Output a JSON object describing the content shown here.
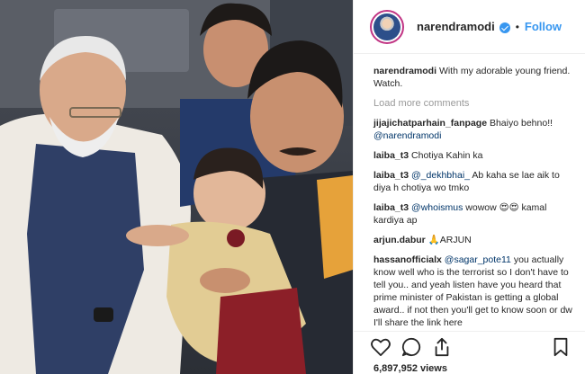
{
  "post": {
    "author": "narendramodi",
    "follow_label": "Follow",
    "separator": "•",
    "caption": "With my adorable young friend. Watch.",
    "load_more": "Load more comments",
    "views": "6,897,952 views"
  },
  "comments": [
    {
      "user": "jijajichatparhain_fanpage",
      "parts": [
        {
          "t": "Bhaiyo behno!! "
        },
        {
          "t": "@narendramodi",
          "mention": true
        }
      ]
    },
    {
      "user": "laiba_t3",
      "parts": [
        {
          "t": "Chotiya Kahin ka"
        }
      ]
    },
    {
      "user": "laiba_t3",
      "parts": [
        {
          "t": "@_dekhbhai_",
          "mention": true
        },
        {
          "t": " Ab kaha se lae aik to diya h chotiya wo tmko"
        }
      ]
    },
    {
      "user": "laiba_t3",
      "parts": [
        {
          "t": "@whoismus",
          "mention": true
        },
        {
          "t": " wowow 😍😍 kamal kardiya ap"
        }
      ]
    },
    {
      "user": "arjun.dabur",
      "parts": [
        {
          "t": "🙏ARJUN"
        }
      ]
    },
    {
      "user": "hassanofficialx",
      "parts": [
        {
          "t": "@sagar_pote11",
          "mention": true
        },
        {
          "t": " you actually know well who is the terrorist so I don't have to tell you.. and yeah listen have you heard that prime minister of Pakistan is getting a global award.. if not then you'll get to know soon or dw I'll share the link here"
        }
      ]
    }
  ],
  "icons": {
    "like": "heart-icon",
    "comment": "comment-icon",
    "share": "share-icon",
    "save": "bookmark-icon",
    "verified": "verified-badge-icon"
  },
  "colors": {
    "link": "#3897f0",
    "mention": "#003569",
    "muted": "#999999",
    "text": "#262626"
  }
}
